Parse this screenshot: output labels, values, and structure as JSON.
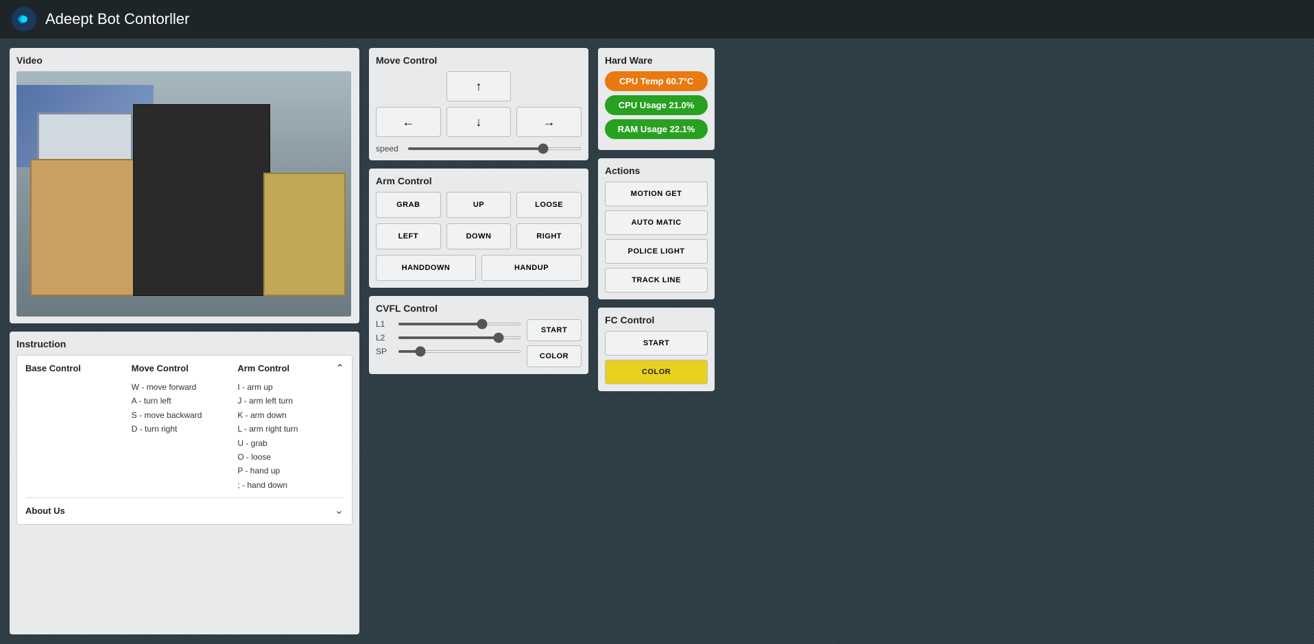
{
  "app": {
    "title": "Adeept Bot Contorller"
  },
  "header": {
    "logo_alt": "Adeept Logo"
  },
  "video_panel": {
    "title": "Video"
  },
  "instruction_panel": {
    "title": "Instruction",
    "columns": {
      "base_control": "Base Control",
      "move_control": "Move Control",
      "arm_control": "Arm Control"
    },
    "base_control_items": [],
    "move_control_items": [
      "W - move forward",
      "A - turn left",
      "S - move backward",
      "D - turn right"
    ],
    "arm_control_items": [
      "I - arm up",
      "J - arm left turn",
      "K - arm down",
      "L - arm right turn",
      "U - grab",
      "O - loose",
      "P - hand up",
      "; - hand down"
    ],
    "about_us_label": "About Us"
  },
  "move_control": {
    "title": "Move Control",
    "speed_label": "speed",
    "speed_value": 80,
    "up_icon": "↑",
    "down_icon": "↓",
    "left_icon": "←",
    "right_icon": "→"
  },
  "arm_control": {
    "title": "Arm Control",
    "buttons": [
      "GRAB",
      "UP",
      "LOOSE",
      "LEFT",
      "DOWN",
      "RIGHT"
    ],
    "bottom_buttons": [
      "HANDDOWN",
      "HANDUP"
    ]
  },
  "cvfl_control": {
    "title": "CVFL Control",
    "l1_label": "L1",
    "l1_value": 70,
    "l2_label": "L2",
    "l2_value": 85,
    "sp_label": "SP",
    "sp_value": 15,
    "start_label": "START",
    "color_label": "COLOR"
  },
  "hardware": {
    "title": "Hard Ware",
    "cpu_temp_label": "CPU Temp 60.7°C",
    "cpu_usage_label": "CPU Usage 21.0%",
    "ram_usage_label": "RAM Usage 22.1%"
  },
  "actions": {
    "title": "Actions",
    "buttons": [
      "MOTION GET",
      "AUTO MATIC",
      "POLICE LIGHT",
      "TRACK LINE"
    ]
  },
  "fc_control": {
    "title": "FC Control",
    "start_label": "START",
    "color_label": "COLOR"
  }
}
